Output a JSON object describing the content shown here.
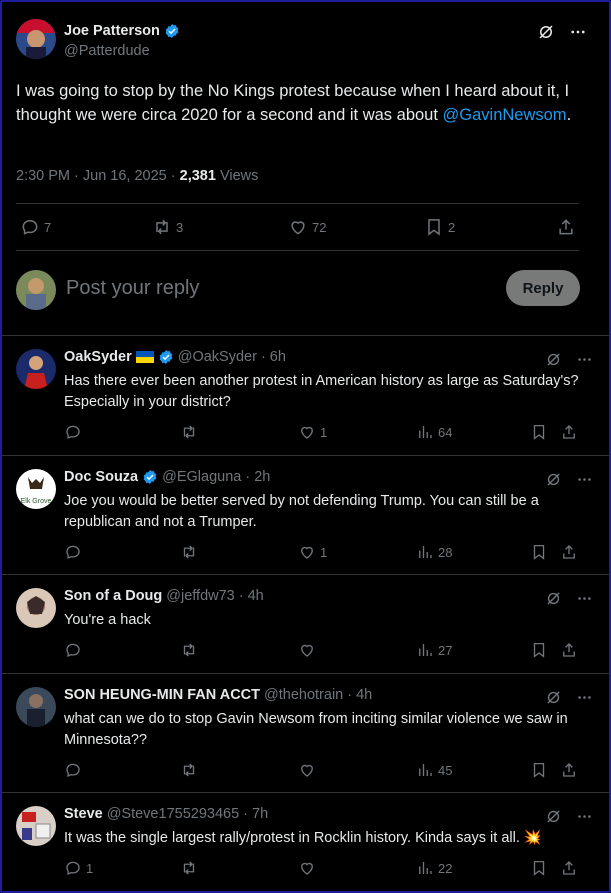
{
  "tweet": {
    "author_name": "Joe Patterson",
    "author_handle": "@Patterdude",
    "text_before_link": "I was going to stop by the No Kings protest because when I heard about it, I thought we were circa 2020 for a second and it was about ",
    "link_text": "@GavinNewsom",
    "text_after_link": ".",
    "time": "2:30 PM · Jun 16, 2025 · ",
    "views_count": "2,381",
    "views_label": " Views",
    "replies": "7",
    "reposts": "3",
    "likes": "72",
    "bookmarks": "2"
  },
  "reply_composer": {
    "placeholder": "Post your reply",
    "button": "Reply"
  },
  "replies": [
    {
      "name": "OakSyder",
      "handle": "@OakSyder · 6h",
      "text": "Has there ever been another protest in American history as large as Saturday's? Especially in your district?",
      "replies": "",
      "reposts": "",
      "likes": "1",
      "views": "64"
    },
    {
      "name": "Doc Souza",
      "handle": "@EGlaguna · 2h",
      "text": "Joe you would be better served by not defending Trump. You can still be a republican and not a Trumper.",
      "replies": "",
      "reposts": "",
      "likes": "1",
      "views": "28"
    },
    {
      "name": "Son of a Doug",
      "handle": "@jeffdw73 · 4h",
      "text": "You're a hack",
      "replies": "",
      "reposts": "",
      "likes": "",
      "views": "27"
    },
    {
      "name": "SON HEUNG-MIN FAN ACCT",
      "handle": "@thehotrain · 4h",
      "text": "what can we do to stop Gavin Newsom from inciting similar violence we saw in Minnesota??",
      "replies": "",
      "reposts": "",
      "likes": "",
      "views": "45"
    },
    {
      "name": "Steve",
      "handle": "@Steve1755293465 · 7h",
      "text": "It was the single largest rally/protest in Rocklin history. Kinda says it all. 💥",
      "replies": "1",
      "reposts": "",
      "likes": "",
      "views": "22"
    }
  ],
  "colors": {
    "background": "#000000",
    "text": "#e7e9ea",
    "muted": "#71767b",
    "link": "#1d9bf0",
    "divider": "#2f3336",
    "verified": "#1d9bf0"
  }
}
